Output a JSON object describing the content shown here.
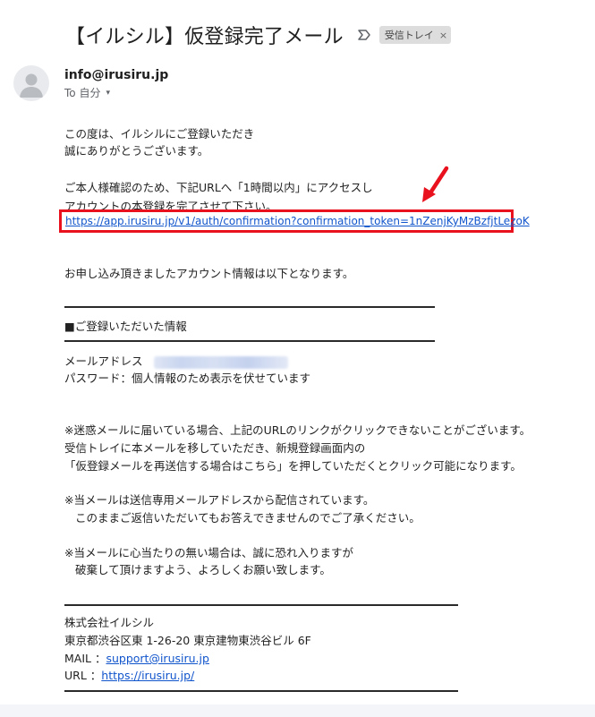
{
  "email": {
    "subject": "【イルシル】仮登録完了メール",
    "label": {
      "name": "受信トレイ",
      "close": "×"
    },
    "sender": {
      "email": "info@irusiru.jp",
      "to_label": "To 自分",
      "caret": "▾"
    }
  },
  "body": {
    "greeting_1": "この度は、イルシルにご登録いただき",
    "greeting_2": "誠にありがとうございます。",
    "instruction_1": "ご本人様確認のため、下記URLへ「1時間以内」にアクセスし",
    "instruction_2": "アカウントの本登録を完了させて下さい。",
    "confirmation_link": "https://app.irusiru.jp/v1/auth/confirmation?confirmation_token=1nZenjKyMzBzfjtLezoK",
    "account_info_intro": "お申し込み頂きましたアカウント情報は以下となります。",
    "section_title": "■ご登録いただいた情報",
    "mail_address_label": "メールアドレス",
    "password_line": "パスワード：個人情報のため表示を伏せています",
    "notice_1a": "※迷惑メールに届いている場合、上記のURLのリンクがクリックできないことがございます。",
    "notice_1b": "受信トレイに本メールを移していただき、新規登録画面内の",
    "notice_1c": "「仮登録メールを再送信する場合はこちら」を押していただくとクリック可能になります。",
    "notice_2a": "※当メールは送信専用メールアドレスから配信されています。",
    "notice_2b": "このままご返信いただいてもお答えできませんのでご了承ください。",
    "notice_3a": "※当メールに心当たりの無い場合は、誠に恐れ入りますが",
    "notice_3b": "破棄して頂けますよう、よろしくお願い致します。"
  },
  "signature": {
    "company": "株式会社イルシル",
    "address": "東京都渋谷区東 1-26-20 東京建物東渋谷ビル 6F",
    "mail_label": "MAIL ：",
    "mail": "support@irusiru.jp",
    "url_label": "URL ：",
    "url": "https://irusiru.jp/"
  },
  "colors": {
    "link": "#1155cc",
    "highlight_border": "#e8111d",
    "arrow": "#e8111d",
    "label_chip_bg": "#dddddd"
  },
  "icons": [
    "label-arrow-icon",
    "avatar-person-icon",
    "red-arrow-icon"
  ]
}
